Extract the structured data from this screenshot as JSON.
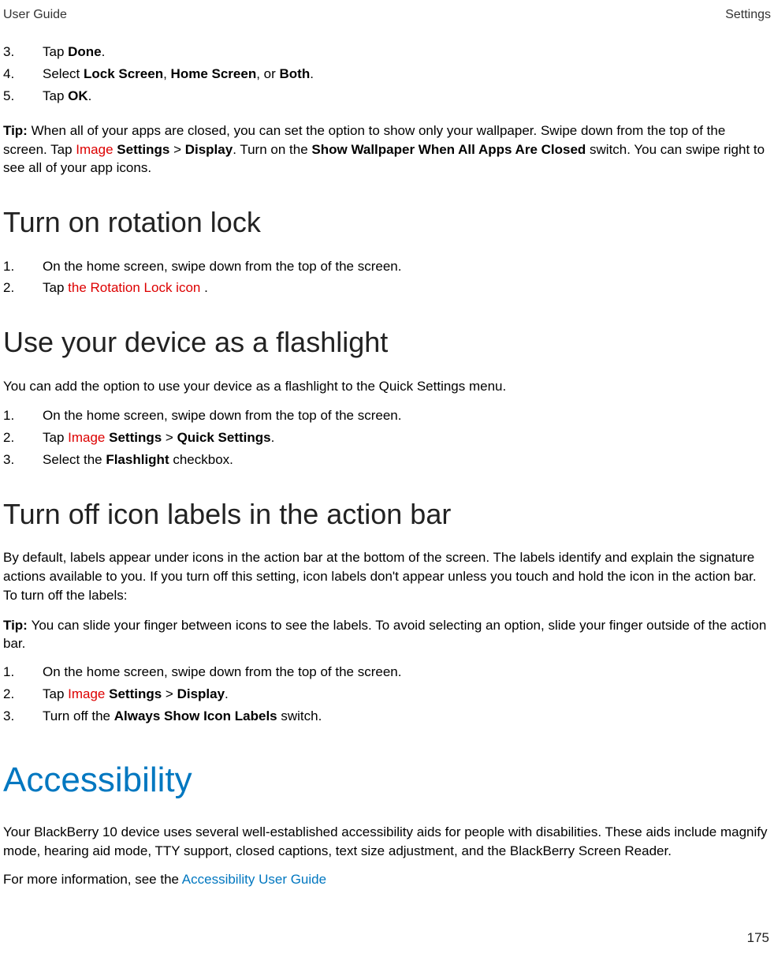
{
  "header": {
    "left": "User Guide",
    "right": "Settings"
  },
  "list1": {
    "items": [
      {
        "num": "3.",
        "text_pre": "Tap ",
        "bold1": "Done",
        "text_post": "."
      },
      {
        "num": "4.",
        "text_pre": "Select ",
        "bold1": "Lock Screen",
        "sep1": ", ",
        "bold2": "Home Screen",
        "sep2": ", or ",
        "bold3": "Both",
        "text_post": "."
      },
      {
        "num": "5.",
        "text_pre": "Tap ",
        "bold1": "OK",
        "text_post": "."
      }
    ]
  },
  "tip1": {
    "label": "Tip: ",
    "pre": "When all of your apps are closed, you can set the option to show only your wallpaper. Swipe down from the top of the screen. Tap ",
    "img": " Image ",
    "bold1": "Settings",
    "sep1": " > ",
    "bold2": "Display",
    "mid": ". Turn on the ",
    "bold3": "Show Wallpaper When All Apps Are Closed",
    "post": " switch. You can swipe right to see all of your app icons."
  },
  "section_rotation": {
    "title": "Turn on rotation lock",
    "items": [
      {
        "num": "1.",
        "text": "On the home screen, swipe down from the top of the screen."
      },
      {
        "num": "2.",
        "pre": "Tap ",
        "red": " the Rotation Lock icon ",
        "post": "."
      }
    ]
  },
  "section_flashlight": {
    "title": "Use your device as a flashlight",
    "intro": "You can add the option to use your device as a flashlight to the Quick Settings menu.",
    "items": [
      {
        "num": "1.",
        "text": "On the home screen, swipe down from the top of the screen."
      },
      {
        "num": "2.",
        "pre": "Tap ",
        "img": " Image ",
        "sep0": " ",
        "bold1": "Settings",
        "sep1": " > ",
        "bold2": "Quick Settings",
        "post": "."
      },
      {
        "num": "3.",
        "pre": "Select the ",
        "bold1": "Flashlight",
        "post": " checkbox."
      }
    ]
  },
  "section_iconlabels": {
    "title": "Turn off icon labels in the action bar",
    "intro": "By default, labels appear under icons in the action bar at the bottom of the screen. The labels identify and explain the signature actions available to you. If you turn off this setting, icon labels don't appear unless you touch and hold the icon in the action bar. To turn off the labels:",
    "tip_label": "Tip: ",
    "tip_text": "You can slide your finger between icons to see the labels. To avoid selecting an option, slide your finger outside of the action bar.",
    "items": [
      {
        "num": "1.",
        "text": "On the home screen, swipe down from the top of the screen."
      },
      {
        "num": "2.",
        "pre": "Tap ",
        "img": " Image ",
        "sep0": " ",
        "bold1": "Settings",
        "sep1": " > ",
        "bold2": "Display",
        "post": "."
      },
      {
        "num": "3.",
        "pre": "Turn off the ",
        "bold1": "Always Show Icon Labels",
        "post": " switch."
      }
    ]
  },
  "chapter_accessibility": {
    "title": "Accessibility",
    "p1": "Your BlackBerry 10 device uses several well-established accessibility aids for people with disabilities. These aids include magnify mode, hearing aid mode, TTY support, closed captions, text size adjustment, and the BlackBerry Screen Reader.",
    "p2_pre": "For more information, see the ",
    "p2_link": "Accessibility User Guide"
  },
  "page_number": "175"
}
